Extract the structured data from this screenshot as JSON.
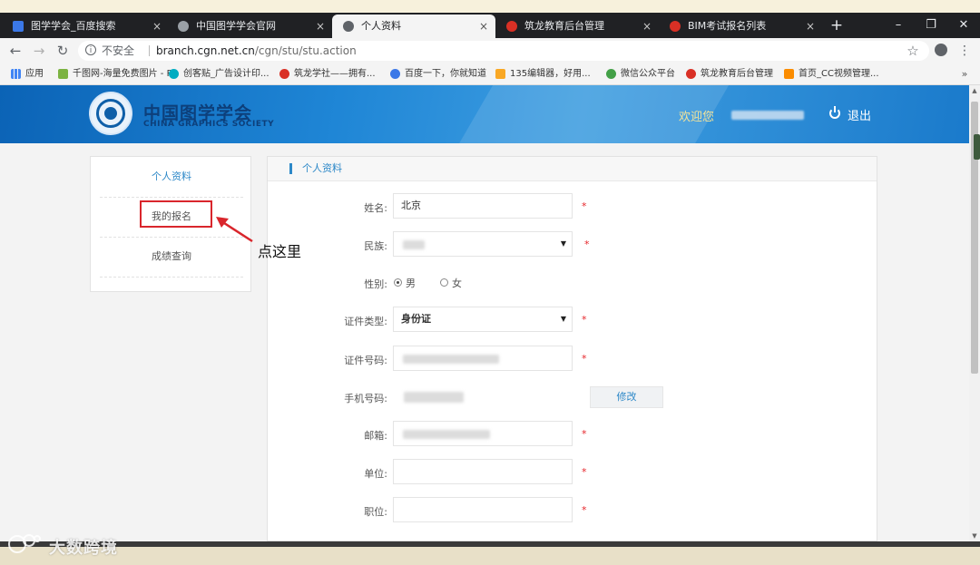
{
  "browser": {
    "tabs": [
      {
        "title": "图学学会_百度搜索",
        "icon_color": "#3b78e7"
      },
      {
        "title": "中国图学学会官网",
        "icon_color": "#9aa0a6"
      },
      {
        "title": "个人资料",
        "icon_color": "#5f6368",
        "active": true
      },
      {
        "title": "筑龙教育后台管理",
        "icon_color": "#d93025"
      },
      {
        "title": "BIM考试报名列表",
        "icon_color": "#d93025"
      }
    ],
    "close_glyph": "×",
    "new_tab_glyph": "+",
    "window_controls": [
      "–",
      "❐",
      "✕"
    ],
    "nav": {
      "back": "←",
      "forward": "→",
      "reload": "↻"
    },
    "address": {
      "security_label": "不安全",
      "host": "branch.cgn.net.cn",
      "path": "/cgn/stu/stu.action"
    },
    "star_glyph": "☆",
    "more_glyph": "⋮",
    "bookmarks": [
      {
        "label": "应用",
        "icon_color": "#4285f4"
      },
      {
        "label": "千图网-海量免费图片 - P...",
        "icon_color": "#7cb342"
      },
      {
        "label": "创客贴_广告设计印...",
        "icon_color": "#00acc1"
      },
      {
        "label": "筑龙学社——拥有...",
        "icon_color": "#d93025"
      },
      {
        "label": "百度一下，你就知道",
        "icon_color": "#3b78e7"
      },
      {
        "label": "135编辑器，好用...",
        "icon_color": "#f9a825"
      },
      {
        "label": "微信公众平台",
        "icon_color": "#43a047"
      },
      {
        "label": "筑龙教育后台管理",
        "icon_color": "#d93025"
      },
      {
        "label": "首页_CC视频管理...",
        "icon_color": "#fb8c00"
      }
    ],
    "bookmarks_overflow": "»"
  },
  "site": {
    "logo_cn": "中国图学学会",
    "logo_en": "CHINA GRAPHICS SOCIETY",
    "welcome": "欢迎您",
    "logout": "退出"
  },
  "sidebar": {
    "items": [
      {
        "label": "个人资料",
        "active": true
      },
      {
        "label": "我的报名",
        "active": false
      },
      {
        "label": "成绩查询",
        "active": false
      }
    ]
  },
  "annotation": {
    "text": "点这里"
  },
  "panel": {
    "title": "个人资料",
    "required_mark": "*",
    "fields": {
      "name": {
        "label": "姓名:",
        "value": "北京"
      },
      "ethnicity": {
        "label": "民族:"
      },
      "gender": {
        "label": "性别:",
        "options": [
          "男",
          "女"
        ],
        "selected": "男"
      },
      "id_type": {
        "label": "证件类型:",
        "value": "身份证"
      },
      "id_number": {
        "label": "证件号码:"
      },
      "phone": {
        "label": "手机号码:",
        "button": "修改"
      },
      "email": {
        "label": "邮箱:"
      },
      "company": {
        "label": "单位:"
      },
      "position": {
        "label": "职位:"
      }
    },
    "caret": "▼"
  },
  "watermark": {
    "text": "大数跨境"
  },
  "colors": {
    "accent": "#2d88c8",
    "required": "#e6252a",
    "highlight": "#d9262c",
    "header": "#1f86d6"
  }
}
